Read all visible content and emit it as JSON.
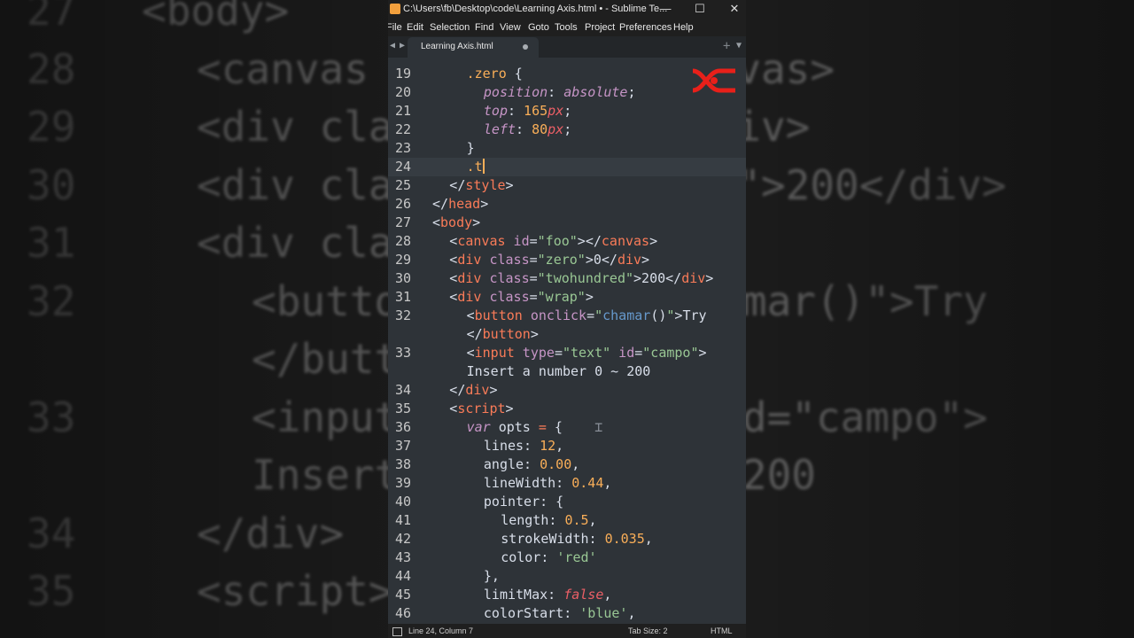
{
  "window": {
    "title": "C:\\Users\\fb\\Desktop\\code\\Learning Axis.html • - Sublime Te...",
    "minimize": "—",
    "maximize": "☐",
    "close": "✕"
  },
  "menu": [
    "File",
    "Edit",
    "Selection",
    "Find",
    "View",
    "Goto",
    "Tools",
    "Project",
    "Preferences",
    "Help"
  ],
  "tab": {
    "label": "Learning Axis.html"
  },
  "status": {
    "position": "Line 24, Column 7",
    "tab_size": "Tab Size: 2",
    "syntax": "HTML"
  },
  "code_lines": [
    {
      "n": "19",
      "indent": 2,
      "tokens": [
        [
          "sel",
          ".zero"
        ],
        [
          "punc",
          " {"
        ]
      ]
    },
    {
      "n": "20",
      "indent": 3,
      "tokens": [
        [
          "prop",
          "position"
        ],
        [
          "punc",
          ": "
        ],
        [
          "val",
          "absolute"
        ],
        [
          "punc",
          ";"
        ]
      ]
    },
    {
      "n": "21",
      "indent": 3,
      "tokens": [
        [
          "prop",
          "top"
        ],
        [
          "punc",
          ": "
        ],
        [
          "num",
          "165"
        ],
        [
          "unit",
          "px"
        ],
        [
          "punc",
          ";"
        ]
      ]
    },
    {
      "n": "22",
      "indent": 3,
      "tokens": [
        [
          "prop",
          "left"
        ],
        [
          "punc",
          ": "
        ],
        [
          "num",
          "80"
        ],
        [
          "unit",
          "px"
        ],
        [
          "punc",
          ";"
        ]
      ]
    },
    {
      "n": "23",
      "indent": 2,
      "tokens": [
        [
          "punc",
          "}"
        ]
      ]
    },
    {
      "n": "24",
      "indent": 2,
      "active": true,
      "tokens": [
        [
          "sel",
          ".t"
        ],
        [
          "cursor",
          ""
        ]
      ]
    },
    {
      "n": "25",
      "indent": 1,
      "tokens": [
        [
          "punc",
          "</"
        ],
        [
          "tag",
          "style"
        ],
        [
          "punc",
          ">"
        ]
      ]
    },
    {
      "n": "26",
      "indent": 0,
      "tokens": [
        [
          "punc",
          "</"
        ],
        [
          "tag",
          "head"
        ],
        [
          "punc",
          ">"
        ]
      ]
    },
    {
      "n": "27",
      "indent": 0,
      "tokens": [
        [
          "punc",
          "<"
        ],
        [
          "tag",
          "body"
        ],
        [
          "punc",
          ">"
        ]
      ]
    },
    {
      "n": "28",
      "indent": 1,
      "tokens": [
        [
          "punc",
          "<"
        ],
        [
          "tag",
          "canvas"
        ],
        [
          "attr",
          " id"
        ],
        [
          "punc",
          "="
        ],
        [
          "str",
          "\"foo\""
        ],
        [
          "punc",
          "></"
        ],
        [
          "tag",
          "canvas"
        ],
        [
          "punc",
          ">"
        ]
      ]
    },
    {
      "n": "29",
      "indent": 1,
      "tokens": [
        [
          "punc",
          "<"
        ],
        [
          "tag",
          "div"
        ],
        [
          "attr",
          " class"
        ],
        [
          "punc",
          "="
        ],
        [
          "str",
          "\"zero\""
        ],
        [
          "punc",
          ">"
        ],
        [
          "text",
          "0"
        ],
        [
          "punc",
          "</"
        ],
        [
          "tag",
          "div"
        ],
        [
          "punc",
          ">"
        ]
      ]
    },
    {
      "n": "30",
      "indent": 1,
      "tokens": [
        [
          "punc",
          "<"
        ],
        [
          "tag",
          "div"
        ],
        [
          "attr",
          " class"
        ],
        [
          "punc",
          "="
        ],
        [
          "str",
          "\"twohundred\""
        ],
        [
          "punc",
          ">"
        ],
        [
          "text",
          "200"
        ],
        [
          "punc",
          "</"
        ],
        [
          "tag",
          "div"
        ],
        [
          "punc",
          ">"
        ]
      ]
    },
    {
      "n": "31",
      "indent": 1,
      "tokens": [
        [
          "punc",
          "<"
        ],
        [
          "tag",
          "div"
        ],
        [
          "attr",
          " class"
        ],
        [
          "punc",
          "="
        ],
        [
          "str",
          "\"wrap\""
        ],
        [
          "punc",
          ">"
        ]
      ]
    },
    {
      "n": "32",
      "indent": 2,
      "tokens": [
        [
          "punc",
          "<"
        ],
        [
          "tag",
          "button"
        ],
        [
          "attr",
          " onclick"
        ],
        [
          "punc",
          "="
        ],
        [
          "str",
          "\""
        ],
        [
          "fn",
          "chamar"
        ],
        [
          "punc",
          "()"
        ],
        [
          "str",
          "\""
        ],
        [
          "punc",
          ">"
        ],
        [
          "text",
          "Try"
        ]
      ]
    },
    {
      "n": "",
      "indent": 2,
      "tokens": [
        [
          "punc",
          "</"
        ],
        [
          "tag",
          "button"
        ],
        [
          "punc",
          ">"
        ]
      ]
    },
    {
      "n": "33",
      "indent": 2,
      "tokens": [
        [
          "punc",
          "<"
        ],
        [
          "tag",
          "input"
        ],
        [
          "attr",
          " type"
        ],
        [
          "punc",
          "="
        ],
        [
          "str",
          "\"text\""
        ],
        [
          "attr",
          " id"
        ],
        [
          "punc",
          "="
        ],
        [
          "str",
          "\"campo\""
        ],
        [
          "punc",
          ">"
        ]
      ]
    },
    {
      "n": "",
      "indent": 2,
      "tokens": [
        [
          "text",
          "Insert a number 0 ~ 200"
        ]
      ]
    },
    {
      "n": "34",
      "indent": 1,
      "tokens": [
        [
          "punc",
          "</"
        ],
        [
          "tag",
          "div"
        ],
        [
          "punc",
          ">"
        ]
      ]
    },
    {
      "n": "35",
      "indent": 1,
      "tokens": [
        [
          "punc",
          "<"
        ],
        [
          "tag",
          "script"
        ],
        [
          "punc",
          ">"
        ]
      ]
    },
    {
      "n": "36",
      "indent": 2,
      "tokens": [
        [
          "kw",
          "var"
        ],
        [
          "text",
          " opts "
        ],
        [
          "tag",
          "="
        ],
        [
          "punc",
          " {"
        ],
        [
          "dim",
          "    ⌶"
        ]
      ]
    },
    {
      "n": "37",
      "indent": 3,
      "tokens": [
        [
          "text",
          "lines"
        ],
        [
          "punc",
          ": "
        ],
        [
          "num",
          "12"
        ],
        [
          "punc",
          ","
        ]
      ]
    },
    {
      "n": "38",
      "indent": 3,
      "tokens": [
        [
          "text",
          "angle"
        ],
        [
          "punc",
          ": "
        ],
        [
          "num",
          "0.00"
        ],
        [
          "punc",
          ","
        ]
      ]
    },
    {
      "n": "39",
      "indent": 3,
      "tokens": [
        [
          "text",
          "lineWidth"
        ],
        [
          "punc",
          ": "
        ],
        [
          "num",
          "0.44"
        ],
        [
          "punc",
          ","
        ]
      ]
    },
    {
      "n": "40",
      "indent": 3,
      "tokens": [
        [
          "text",
          "pointer"
        ],
        [
          "punc",
          ": {"
        ]
      ]
    },
    {
      "n": "41",
      "indent": 4,
      "tokens": [
        [
          "text",
          "length"
        ],
        [
          "punc",
          ": "
        ],
        [
          "num",
          "0.5"
        ],
        [
          "punc",
          ","
        ]
      ]
    },
    {
      "n": "42",
      "indent": 4,
      "tokens": [
        [
          "text",
          "strokeWidth"
        ],
        [
          "punc",
          ": "
        ],
        [
          "num",
          "0.035"
        ],
        [
          "punc",
          ","
        ]
      ]
    },
    {
      "n": "43",
      "indent": 4,
      "tokens": [
        [
          "text",
          "color"
        ],
        [
          "punc",
          ": "
        ],
        [
          "str",
          "'red'"
        ]
      ]
    },
    {
      "n": "44",
      "indent": 3,
      "tokens": [
        [
          "punc",
          "},"
        ]
      ]
    },
    {
      "n": "45",
      "indent": 3,
      "tokens": [
        [
          "text",
          "limitMax"
        ],
        [
          "punc",
          ": "
        ],
        [
          "bool",
          "false"
        ],
        [
          "punc",
          ","
        ]
      ]
    },
    {
      "n": "46",
      "indent": 3,
      "tokens": [
        [
          "text",
          "colorStart"
        ],
        [
          "punc",
          ": "
        ],
        [
          "str",
          "'blue'"
        ],
        [
          "punc",
          ","
        ]
      ]
    }
  ],
  "background_lines": [
    {
      "n": "27",
      "indent": 0,
      "text": "<body>"
    },
    {
      "n": "28",
      "indent": 1,
      "text": "<canvas id=\"foo\"></canvas>"
    },
    {
      "n": "29",
      "indent": 1,
      "text": "<div class=\"zero\">0</div>"
    },
    {
      "n": "30",
      "indent": 1,
      "text": "<div class=\"twohundred\">200</div>"
    },
    {
      "n": "31",
      "indent": 1,
      "text": "<div class=\"wrap\">"
    },
    {
      "n": "32",
      "indent": 2,
      "text": "<button onclick=\"chamar()\">Try"
    },
    {
      "n": "",
      "indent": 2,
      "text": "</button>"
    },
    {
      "n": "33",
      "indent": 2,
      "text": "<input type=\"text\" id=\"campo\">"
    },
    {
      "n": "",
      "indent": 2,
      "text": "Insert a number 0 ~ 200"
    },
    {
      "n": "34",
      "indent": 1,
      "text": "</div>"
    },
    {
      "n": "35",
      "indent": 1,
      "text": "<script>"
    }
  ],
  "colors": {
    "editor_bg": "#2e3338",
    "active_line": "#363c42",
    "logo": "#e8201a"
  }
}
